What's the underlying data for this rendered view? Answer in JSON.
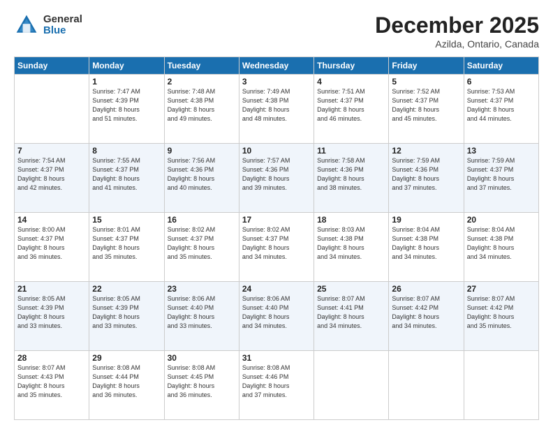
{
  "logo": {
    "general": "General",
    "blue": "Blue"
  },
  "title": {
    "month": "December 2025",
    "location": "Azilda, Ontario, Canada"
  },
  "weekdays": [
    "Sunday",
    "Monday",
    "Tuesday",
    "Wednesday",
    "Thursday",
    "Friday",
    "Saturday"
  ],
  "weeks": [
    [
      {
        "day": "",
        "info": ""
      },
      {
        "day": "1",
        "info": "Sunrise: 7:47 AM\nSunset: 4:39 PM\nDaylight: 8 hours\nand 51 minutes."
      },
      {
        "day": "2",
        "info": "Sunrise: 7:48 AM\nSunset: 4:38 PM\nDaylight: 8 hours\nand 49 minutes."
      },
      {
        "day": "3",
        "info": "Sunrise: 7:49 AM\nSunset: 4:38 PM\nDaylight: 8 hours\nand 48 minutes."
      },
      {
        "day": "4",
        "info": "Sunrise: 7:51 AM\nSunset: 4:37 PM\nDaylight: 8 hours\nand 46 minutes."
      },
      {
        "day": "5",
        "info": "Sunrise: 7:52 AM\nSunset: 4:37 PM\nDaylight: 8 hours\nand 45 minutes."
      },
      {
        "day": "6",
        "info": "Sunrise: 7:53 AM\nSunset: 4:37 PM\nDaylight: 8 hours\nand 44 minutes."
      }
    ],
    [
      {
        "day": "7",
        "info": "Sunrise: 7:54 AM\nSunset: 4:37 PM\nDaylight: 8 hours\nand 42 minutes."
      },
      {
        "day": "8",
        "info": "Sunrise: 7:55 AM\nSunset: 4:37 PM\nDaylight: 8 hours\nand 41 minutes."
      },
      {
        "day": "9",
        "info": "Sunrise: 7:56 AM\nSunset: 4:36 PM\nDaylight: 8 hours\nand 40 minutes."
      },
      {
        "day": "10",
        "info": "Sunrise: 7:57 AM\nSunset: 4:36 PM\nDaylight: 8 hours\nand 39 minutes."
      },
      {
        "day": "11",
        "info": "Sunrise: 7:58 AM\nSunset: 4:36 PM\nDaylight: 8 hours\nand 38 minutes."
      },
      {
        "day": "12",
        "info": "Sunrise: 7:59 AM\nSunset: 4:36 PM\nDaylight: 8 hours\nand 37 minutes."
      },
      {
        "day": "13",
        "info": "Sunrise: 7:59 AM\nSunset: 4:37 PM\nDaylight: 8 hours\nand 37 minutes."
      }
    ],
    [
      {
        "day": "14",
        "info": "Sunrise: 8:00 AM\nSunset: 4:37 PM\nDaylight: 8 hours\nand 36 minutes."
      },
      {
        "day": "15",
        "info": "Sunrise: 8:01 AM\nSunset: 4:37 PM\nDaylight: 8 hours\nand 35 minutes."
      },
      {
        "day": "16",
        "info": "Sunrise: 8:02 AM\nSunset: 4:37 PM\nDaylight: 8 hours\nand 35 minutes."
      },
      {
        "day": "17",
        "info": "Sunrise: 8:02 AM\nSunset: 4:37 PM\nDaylight: 8 hours\nand 34 minutes."
      },
      {
        "day": "18",
        "info": "Sunrise: 8:03 AM\nSunset: 4:38 PM\nDaylight: 8 hours\nand 34 minutes."
      },
      {
        "day": "19",
        "info": "Sunrise: 8:04 AM\nSunset: 4:38 PM\nDaylight: 8 hours\nand 34 minutes."
      },
      {
        "day": "20",
        "info": "Sunrise: 8:04 AM\nSunset: 4:38 PM\nDaylight: 8 hours\nand 34 minutes."
      }
    ],
    [
      {
        "day": "21",
        "info": "Sunrise: 8:05 AM\nSunset: 4:39 PM\nDaylight: 8 hours\nand 33 minutes."
      },
      {
        "day": "22",
        "info": "Sunrise: 8:05 AM\nSunset: 4:39 PM\nDaylight: 8 hours\nand 33 minutes."
      },
      {
        "day": "23",
        "info": "Sunrise: 8:06 AM\nSunset: 4:40 PM\nDaylight: 8 hours\nand 33 minutes."
      },
      {
        "day": "24",
        "info": "Sunrise: 8:06 AM\nSunset: 4:40 PM\nDaylight: 8 hours\nand 34 minutes."
      },
      {
        "day": "25",
        "info": "Sunrise: 8:07 AM\nSunset: 4:41 PM\nDaylight: 8 hours\nand 34 minutes."
      },
      {
        "day": "26",
        "info": "Sunrise: 8:07 AM\nSunset: 4:42 PM\nDaylight: 8 hours\nand 34 minutes."
      },
      {
        "day": "27",
        "info": "Sunrise: 8:07 AM\nSunset: 4:42 PM\nDaylight: 8 hours\nand 35 minutes."
      }
    ],
    [
      {
        "day": "28",
        "info": "Sunrise: 8:07 AM\nSunset: 4:43 PM\nDaylight: 8 hours\nand 35 minutes."
      },
      {
        "day": "29",
        "info": "Sunrise: 8:08 AM\nSunset: 4:44 PM\nDaylight: 8 hours\nand 36 minutes."
      },
      {
        "day": "30",
        "info": "Sunrise: 8:08 AM\nSunset: 4:45 PM\nDaylight: 8 hours\nand 36 minutes."
      },
      {
        "day": "31",
        "info": "Sunrise: 8:08 AM\nSunset: 4:46 PM\nDaylight: 8 hours\nand 37 minutes."
      },
      {
        "day": "",
        "info": ""
      },
      {
        "day": "",
        "info": ""
      },
      {
        "day": "",
        "info": ""
      }
    ]
  ]
}
